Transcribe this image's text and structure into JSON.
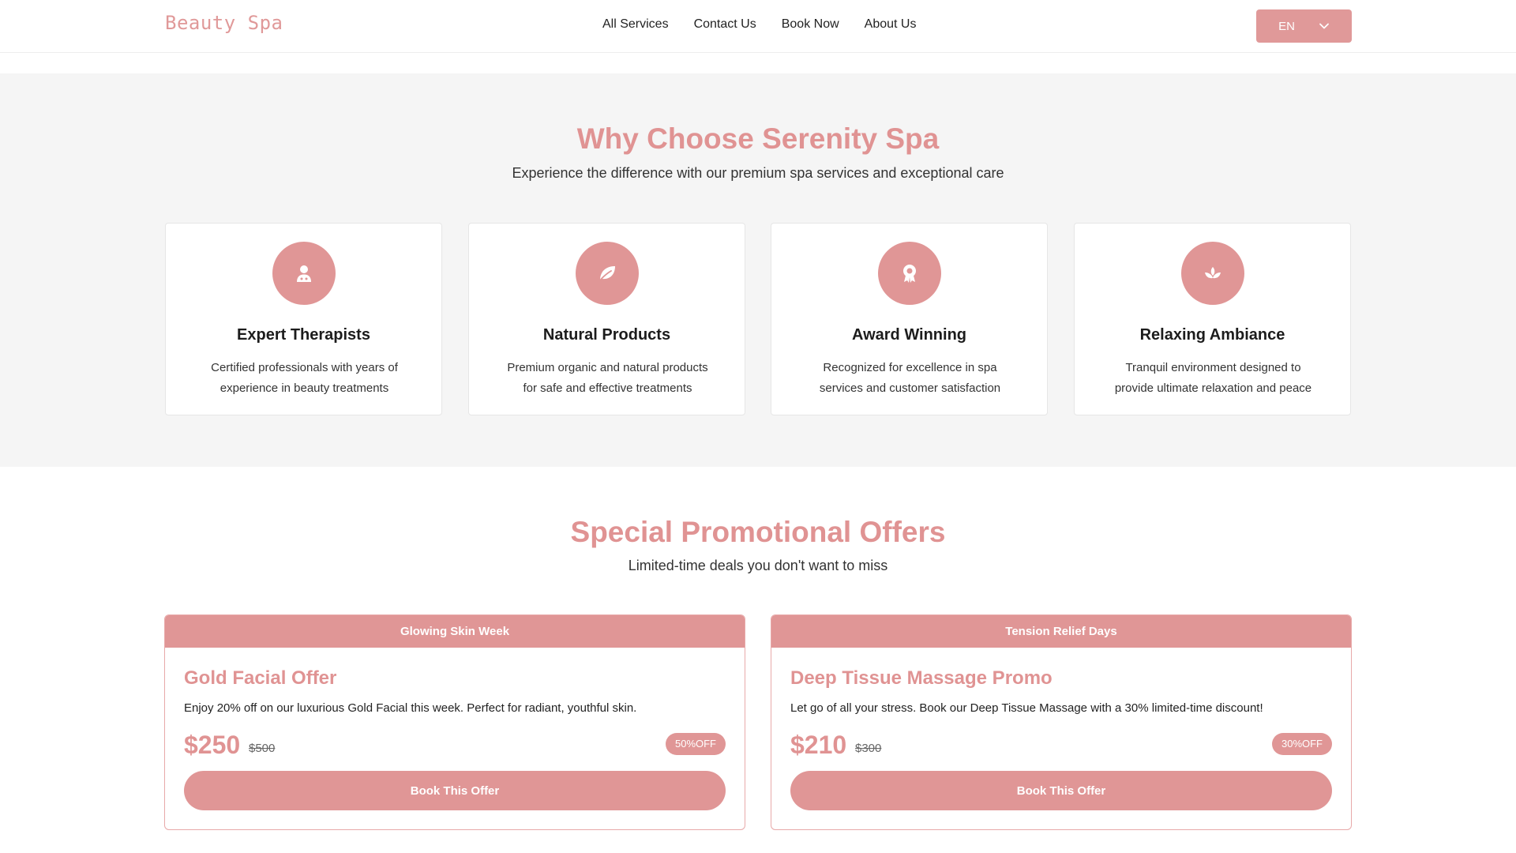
{
  "header": {
    "logo": "Beauty Spa",
    "nav": [
      "All Services",
      "Contact Us",
      "Book Now",
      "About Us"
    ],
    "language": "EN"
  },
  "why": {
    "title": "Why Choose Serenity Spa",
    "subtitle": "Experience the difference with our premium spa services and exceptional care",
    "features": [
      {
        "icon": "therapist-icon",
        "title": "Expert Therapists",
        "desc": "Certified professionals with years of experience in beauty treatments"
      },
      {
        "icon": "leaf-icon",
        "title": "Natural Products",
        "desc": "Premium organic and natural products for safe and effective treatments"
      },
      {
        "icon": "award-icon",
        "title": "Award Winning",
        "desc": "Recognized for excellence in spa services and customer satisfaction"
      },
      {
        "icon": "lotus-icon",
        "title": "Relaxing Ambiance",
        "desc": "Tranquil environment designed to provide ultimate relaxation and peace"
      }
    ]
  },
  "promos": {
    "title": "Special Promotional Offers",
    "subtitle": "Limited-time deals you don't want to miss",
    "offers": [
      {
        "tag": "Glowing Skin Week",
        "title": "Gold Facial Offer",
        "desc": "Enjoy 20% off on our luxurious Gold Facial this week. Perfect for radiant, youthful skin.",
        "price": "$250",
        "old_price": "$500",
        "badge": "50%OFF",
        "button": "Book This Offer"
      },
      {
        "tag": "Tension Relief Days",
        "title": "Deep Tissue Massage Promo",
        "desc": "Let go of all your stress. Book our Deep Tissue Massage with a 30% limited-time discount!",
        "price": "$210",
        "old_price": "$300",
        "badge": "30%OFF",
        "button": "Book This Offer"
      }
    ]
  },
  "colors": {
    "accent": "#e09696",
    "title": "#e09393",
    "section_bg": "#f5f5f5"
  }
}
